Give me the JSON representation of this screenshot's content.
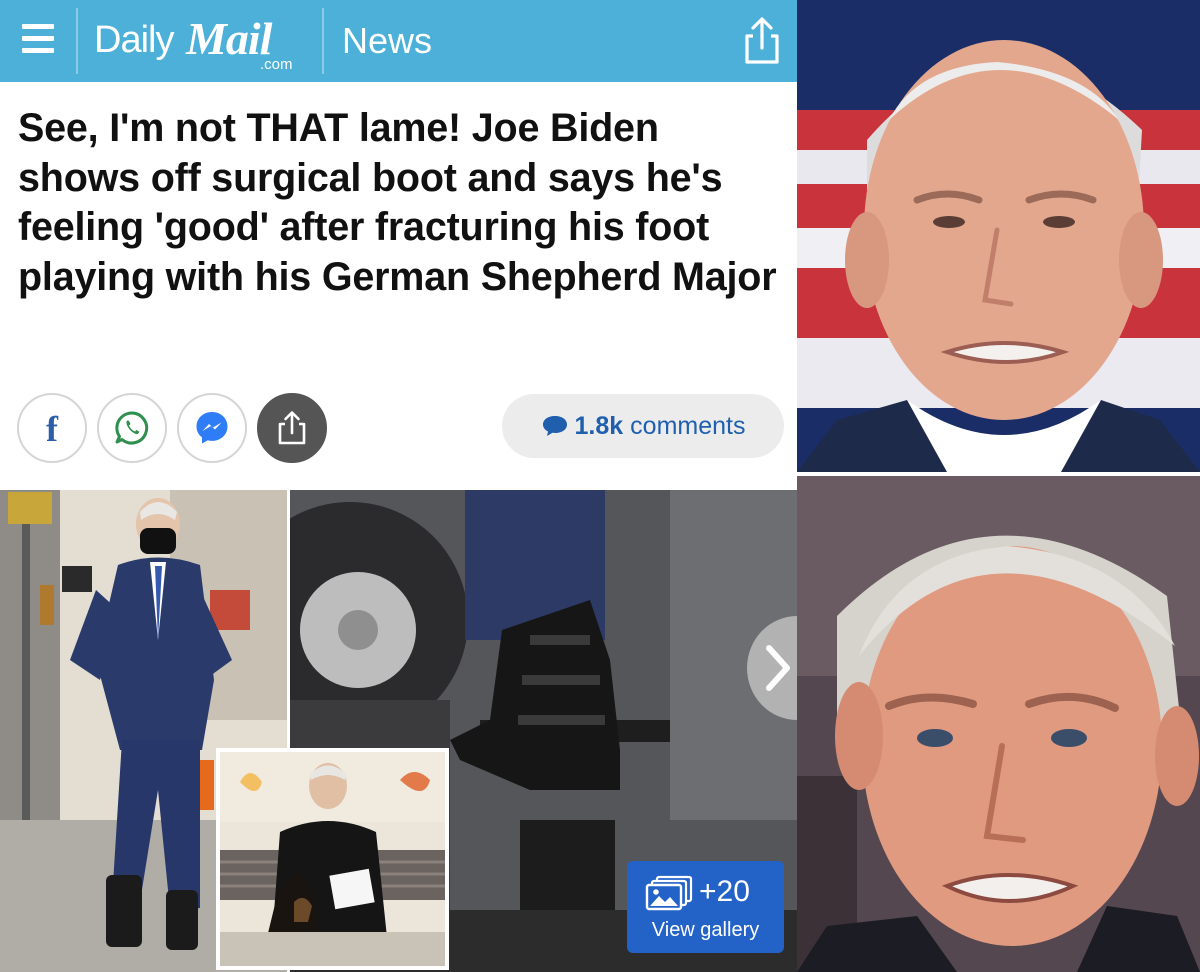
{
  "header": {
    "brand_daily": "Daily",
    "brand_mail": "Mail",
    "brand_com": ".com",
    "section": "News",
    "bar_color": "#4db0d8",
    "menu_icon": "hamburger-menu-icon",
    "share_icon": "share-icon"
  },
  "article": {
    "headline": "See, I'm not THAT lame! Joe Biden shows off surgical boot and says he's feeling 'good' after fracturing his foot playing with his German Shepherd Major"
  },
  "share_bar": {
    "buttons": [
      {
        "name": "facebook",
        "glyph": "f",
        "icon": "facebook-icon"
      },
      {
        "name": "whatsapp",
        "icon": "whatsapp-icon"
      },
      {
        "name": "messenger",
        "icon": "messenger-icon"
      },
      {
        "name": "share",
        "icon": "share-icon"
      }
    ],
    "comments_count": "1.8k",
    "comments_label": "comments",
    "accent_color": "#1f5fae"
  },
  "gallery": {
    "count": "+20",
    "label": "View gallery",
    "button_color": "#2363c8"
  }
}
